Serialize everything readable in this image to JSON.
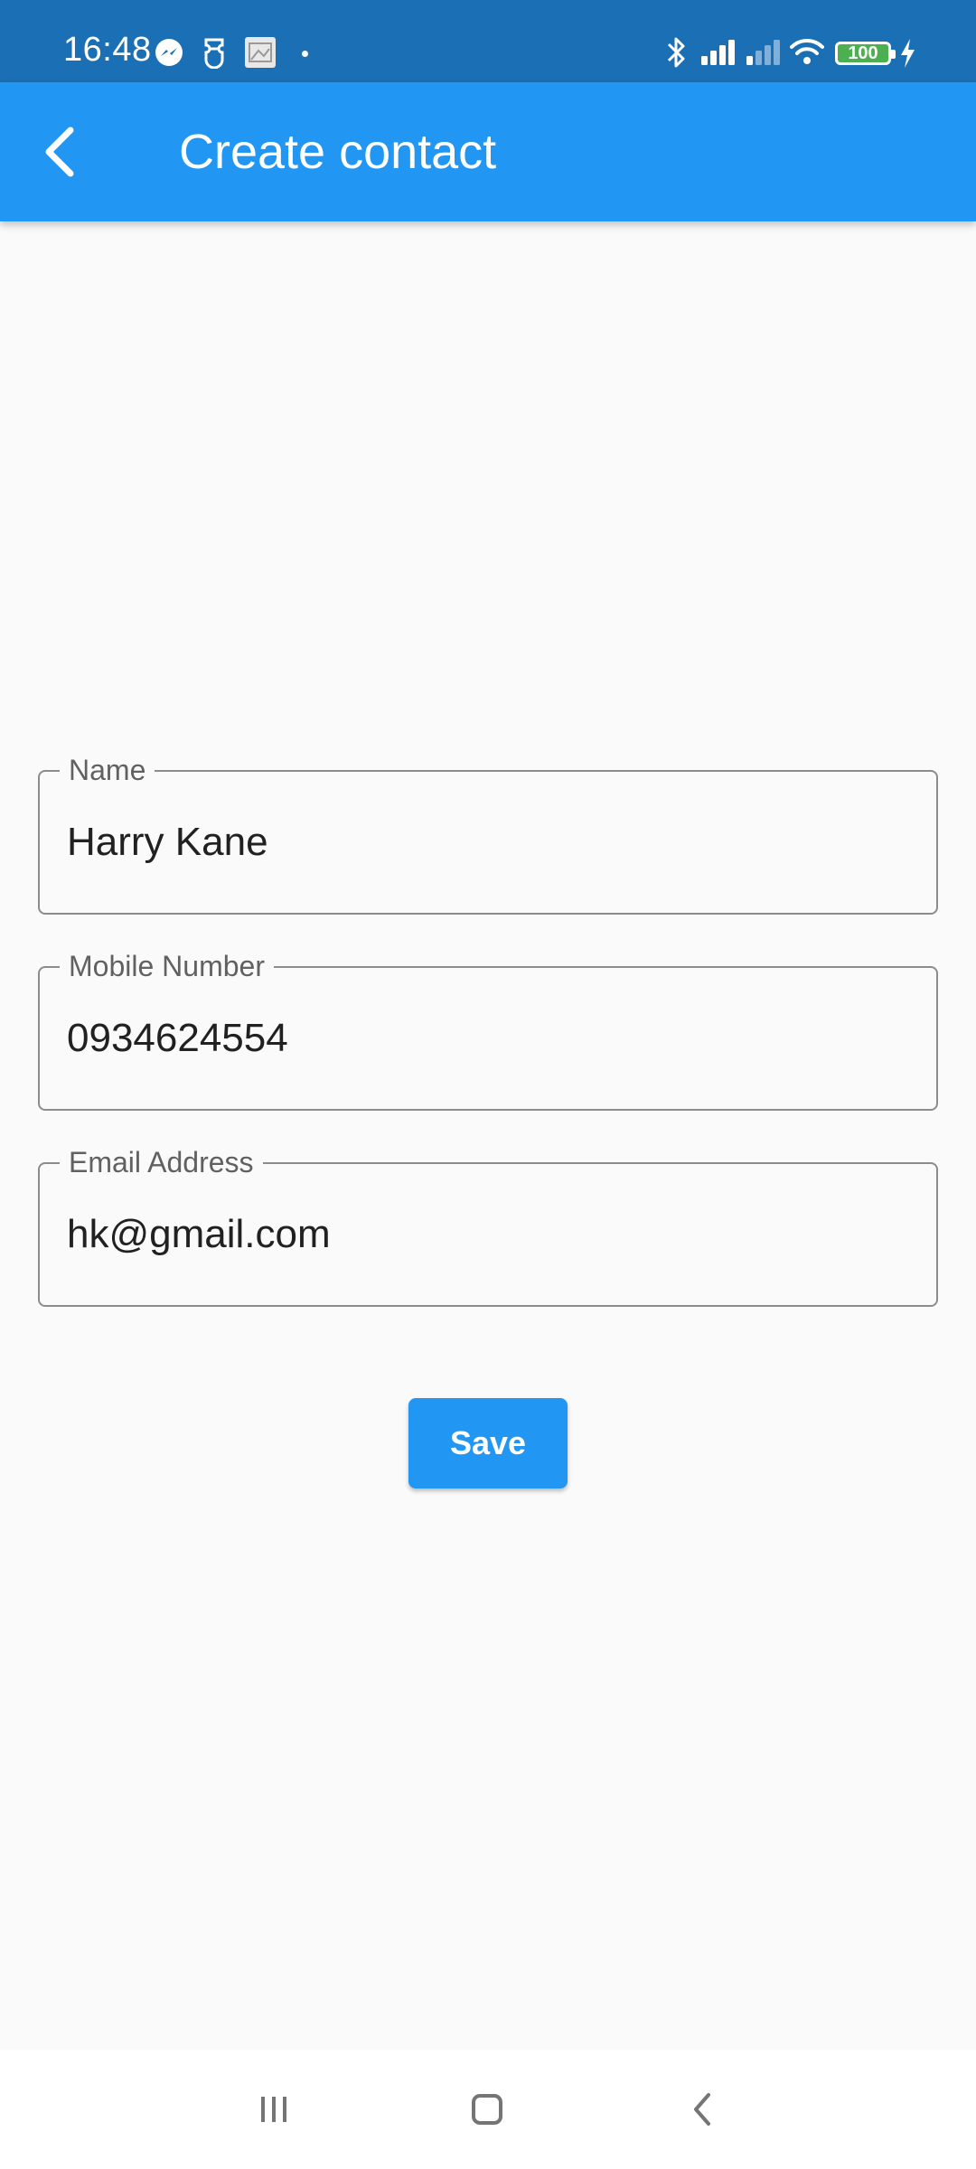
{
  "status_bar": {
    "time": "16:48",
    "battery_level": "100",
    "icons": [
      "messenger-icon",
      "ticket-icon",
      "image-icon",
      "notification-dot-icon",
      "bluetooth-icon",
      "signal-icon",
      "signal-weak-icon",
      "wifi-icon",
      "battery-icon",
      "charging-icon"
    ],
    "colors": {
      "background": "#1a6fb5",
      "battery_fill": "#4caf50"
    }
  },
  "app_bar": {
    "title": "Create contact",
    "back_icon": "chevron-left-icon",
    "color": "#2196f3"
  },
  "form": {
    "fields": [
      {
        "label": "Name",
        "value": "Harry Kane"
      },
      {
        "label": "Mobile Number",
        "value": "0934624554"
      },
      {
        "label": "Email Address",
        "value": "hk@gmail.com"
      }
    ],
    "save_label": "Save"
  },
  "nav_bar": {
    "icons": [
      "recent-apps-icon",
      "home-icon",
      "back-icon"
    ]
  }
}
